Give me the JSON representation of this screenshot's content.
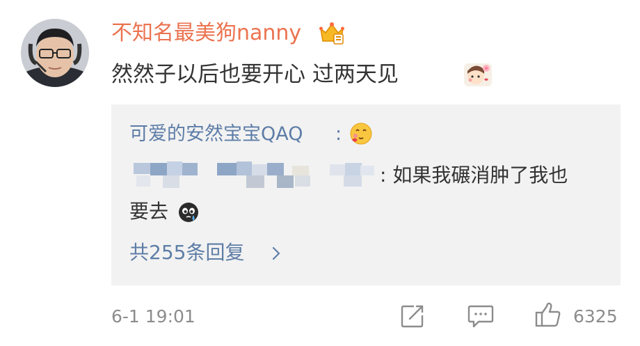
{
  "comment": {
    "username": "不知名最美狗nanny",
    "badge_icon": "crown-badge-icon",
    "text": "然然子以后也要开心 过两天见",
    "sticker_icon": "cute-sticker-icon",
    "reply": {
      "author": "可爱的安然宝宝QAQ",
      "author_colon": ":",
      "author_emoji": "blush-emoji-icon",
      "line1": ": 如果我碾消肿了我也",
      "line2": "要去",
      "line2_emoji": "crying-emoji-icon",
      "more": "共255条回复"
    },
    "timestamp": "6-1 19:01",
    "like_count": "6325",
    "colors": {
      "username": "#eb7350",
      "link": "#5d7da7",
      "text": "#333333",
      "meta": "#8c8c8c",
      "reply_bg": "#f2f2f2"
    }
  }
}
